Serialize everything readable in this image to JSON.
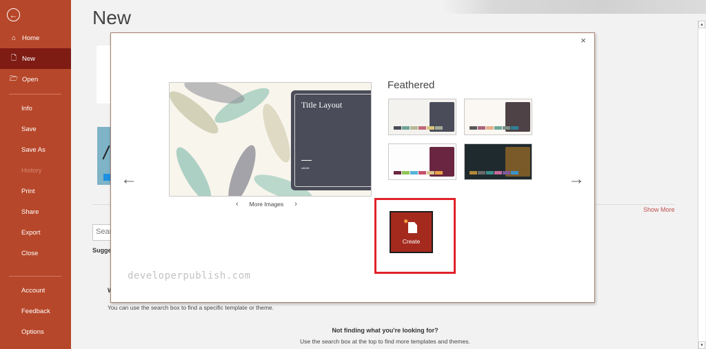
{
  "sidebar": {
    "back_label": "Back",
    "items": [
      {
        "label": "Home",
        "icon": "home-icon",
        "state": "normal"
      },
      {
        "label": "New",
        "icon": "new-document-icon",
        "state": "active"
      },
      {
        "label": "Open",
        "icon": "folder-open-icon",
        "state": "normal"
      },
      {
        "label": "Info",
        "state": "normal"
      },
      {
        "label": "Save",
        "state": "normal"
      },
      {
        "label": "Save As",
        "state": "normal"
      },
      {
        "label": "History",
        "state": "disabled"
      },
      {
        "label": "Print",
        "state": "normal"
      },
      {
        "label": "Share",
        "state": "normal"
      },
      {
        "label": "Export",
        "state": "normal"
      },
      {
        "label": "Close",
        "state": "normal"
      },
      {
        "label": "Account",
        "state": "normal"
      },
      {
        "label": "Feedback",
        "state": "normal"
      },
      {
        "label": "Options",
        "state": "normal"
      }
    ]
  },
  "page": {
    "title": "New",
    "search_placeholder": "Sear",
    "suggested_label": "Sugge",
    "partial_heading": "W",
    "hint_search": "You can use the search box to find a specific template or theme.",
    "not_finding": "Not finding what you're looking for?",
    "hint_top": "Use the search box at the top to find more templates and themes.",
    "show_more": "Show More"
  },
  "dialog": {
    "close_icon": "×",
    "prev_icon": "←",
    "next_icon": "→",
    "preview": {
      "title": "Title Layout",
      "subtitle": "subtitle"
    },
    "more_images": {
      "label": "More Images",
      "prev": "‹",
      "next": "›"
    },
    "theme_name": "Feathered",
    "variants": [
      {
        "name": "variant-1",
        "panel": "#4a4c59",
        "swatches": [
          "#4a4c59",
          "#6fa396",
          "#b7b896",
          "#c0697a",
          "#d9c47e",
          "#a3ab97"
        ]
      },
      {
        "name": "variant-2",
        "panel": "#4e4247",
        "swatches": [
          "#5a5a5a",
          "#a8667a",
          "#e5b08a",
          "#6fa59a",
          "#7d8f86",
          "#2f7f94"
        ]
      },
      {
        "name": "variant-3",
        "panel": "#6a2640",
        "swatches": [
          "#6a2640",
          "#8fc455",
          "#55b3d9",
          "#c6506a",
          "#d9c490",
          "#e7a348"
        ]
      },
      {
        "name": "variant-4",
        "panel": "#7a5a28",
        "swatches": [
          "#b0893a",
          "#6b6b6b",
          "#3a8f8a",
          "#c76a9a",
          "#7d5a9a",
          "#3d92c9"
        ]
      }
    ],
    "create_label": "Create",
    "watermark": "developerpublish.com"
  },
  "colors": {
    "accent": "#b7472a",
    "active_nav": "#7e1b13",
    "highlight": "#e0222b",
    "link": "#c0504d"
  }
}
